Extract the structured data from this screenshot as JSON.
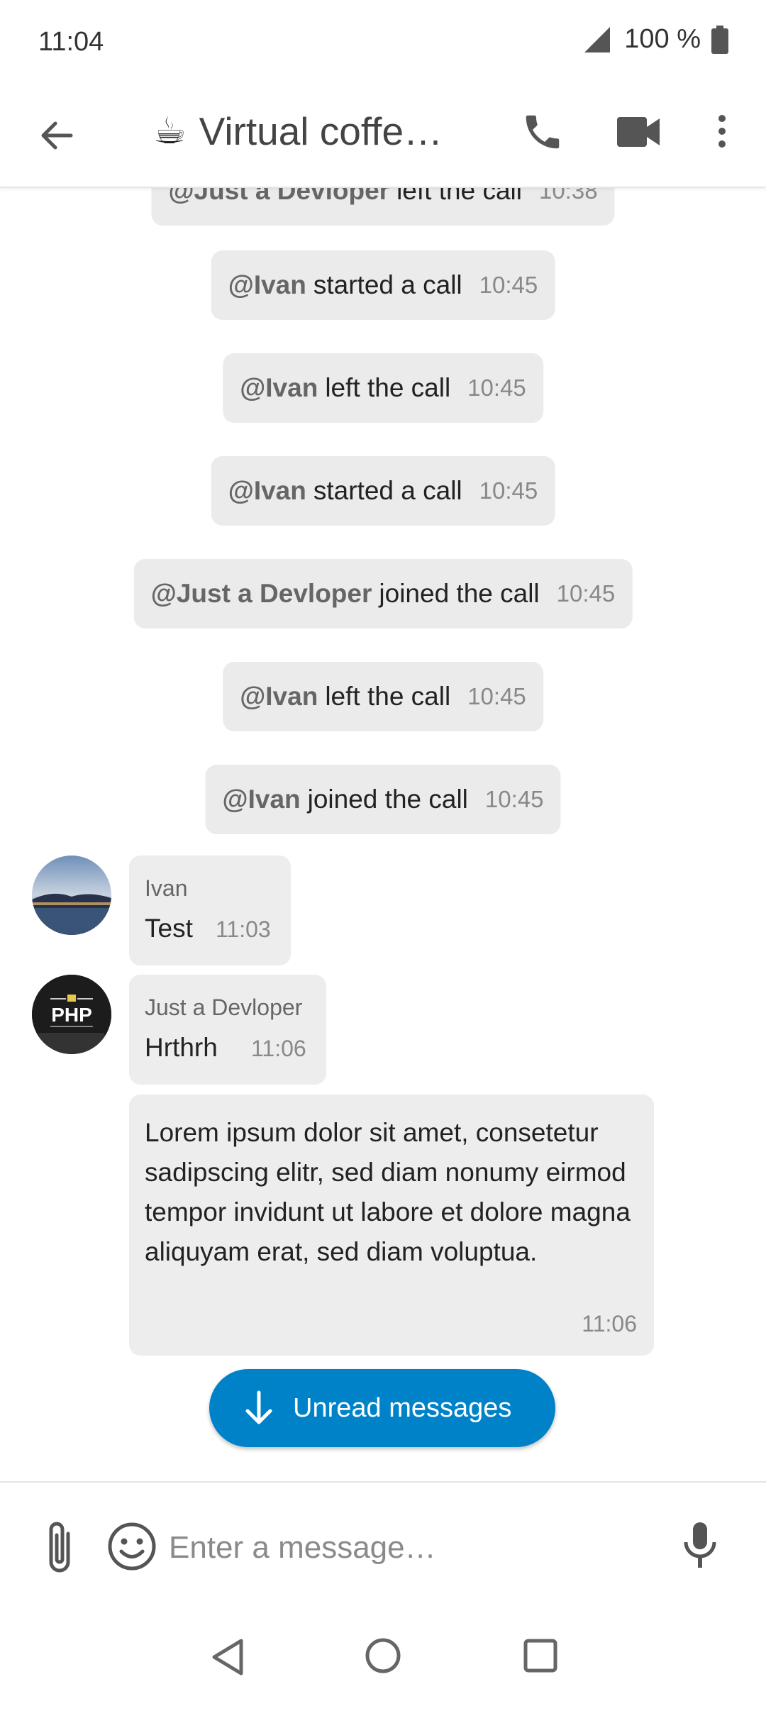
{
  "status_bar": {
    "time": "11:04",
    "battery": "100 %"
  },
  "header": {
    "emoji": "☕",
    "title": "Virtual coffe…"
  },
  "system_messages": [
    {
      "actor": "@Just a Devloper",
      "text": "left the call",
      "time": "10:38"
    },
    {
      "actor": "@Ivan",
      "text": "started a call",
      "time": "10:45"
    },
    {
      "actor": "@Ivan",
      "text": "left the call",
      "time": "10:45"
    },
    {
      "actor": "@Ivan",
      "text": "started a call",
      "time": "10:45"
    },
    {
      "actor": "@Just a Devloper",
      "text": "joined the call",
      "time": "10:45"
    },
    {
      "actor": "@Ivan",
      "text": "left the call",
      "time": "10:45"
    },
    {
      "actor": "@Ivan",
      "text": "joined the call",
      "time": "10:45"
    }
  ],
  "messages": [
    {
      "author": "Ivan",
      "text": "Test",
      "time": "11:03"
    },
    {
      "author": "Just a Devloper",
      "text": "Hrthrh",
      "time": "11:06",
      "avatar_text": "PHP"
    },
    {
      "text": "Lorem ipsum dolor sit amet, consetetur sadipscing elitr, sed diam nonumy eirmod tempor invidunt ut labore et dolore magna aliquyam erat, sed diam voluptua.",
      "time": "11:06"
    }
  ],
  "unread_button": {
    "label": "Unread messages"
  },
  "composer": {
    "placeholder": "Enter a message…"
  },
  "colors": {
    "accent": "#0082c9",
    "bubble": "#ededed",
    "system_bubble": "#ebebeb"
  }
}
